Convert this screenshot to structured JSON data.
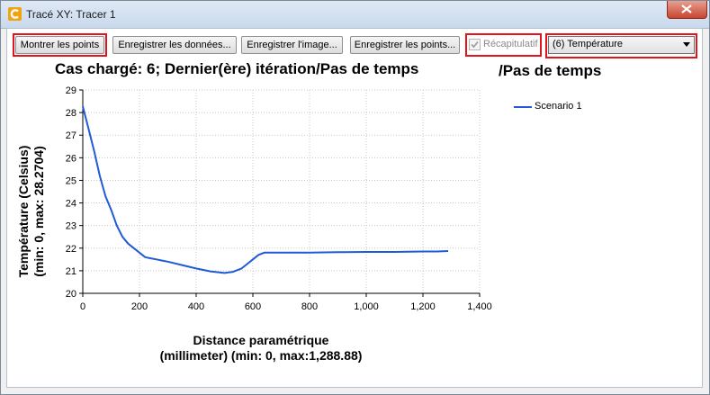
{
  "window": {
    "title": "Tracé XY: Tracer 1"
  },
  "toolbar": {
    "show_points": "Montrer les points",
    "save_data": "Enregistrer les données...",
    "save_image": "Enregistrer l'image...",
    "save_points": "Enregistrer les points...",
    "summary_label": "Récapitulatif",
    "summary_checked": true,
    "variable_select": "(6) Température"
  },
  "chart_data": {
    "type": "line",
    "title": "Cas chargé: 6; Dernier(ère) itération/Pas de temps",
    "subtitle": "/Pas de temps",
    "ylabel_line1": "Température (Celsius)",
    "ylabel_line2": "(min: 0, max: 28.2704)",
    "xlabel_line1": "Distance paramétrique",
    "xlabel_line2": "(millimeter) (min: 0, max:1,288.88)",
    "xlim": [
      0,
      1400
    ],
    "ylim": [
      20,
      29
    ],
    "xticks": [
      "0",
      "200",
      "400",
      "600",
      "800",
      "1,000",
      "1,200",
      "1,400"
    ],
    "yticks": [
      "20",
      "21",
      "22",
      "23",
      "24",
      "25",
      "26",
      "27",
      "28",
      "29"
    ],
    "grid": "dotted",
    "legend": "right",
    "color": "#1f5bd6",
    "series": [
      {
        "name": "Scenario 1",
        "x": [
          0,
          20,
          40,
          60,
          80,
          100,
          120,
          140,
          160,
          180,
          200,
          220,
          240,
          260,
          280,
          300,
          350,
          400,
          450,
          500,
          530,
          560,
          580,
          600,
          620,
          640,
          700,
          800,
          900,
          1000,
          1100,
          1200,
          1250,
          1289
        ],
        "y": [
          28.27,
          27.3,
          26.3,
          25.2,
          24.3,
          23.7,
          23.0,
          22.5,
          22.2,
          22.0,
          21.8,
          21.6,
          21.55,
          21.5,
          21.45,
          21.4,
          21.25,
          21.1,
          20.97,
          20.9,
          20.95,
          21.1,
          21.3,
          21.5,
          21.7,
          21.8,
          21.8,
          21.8,
          21.82,
          21.83,
          21.83,
          21.85,
          21.85,
          21.87
        ]
      }
    ]
  }
}
